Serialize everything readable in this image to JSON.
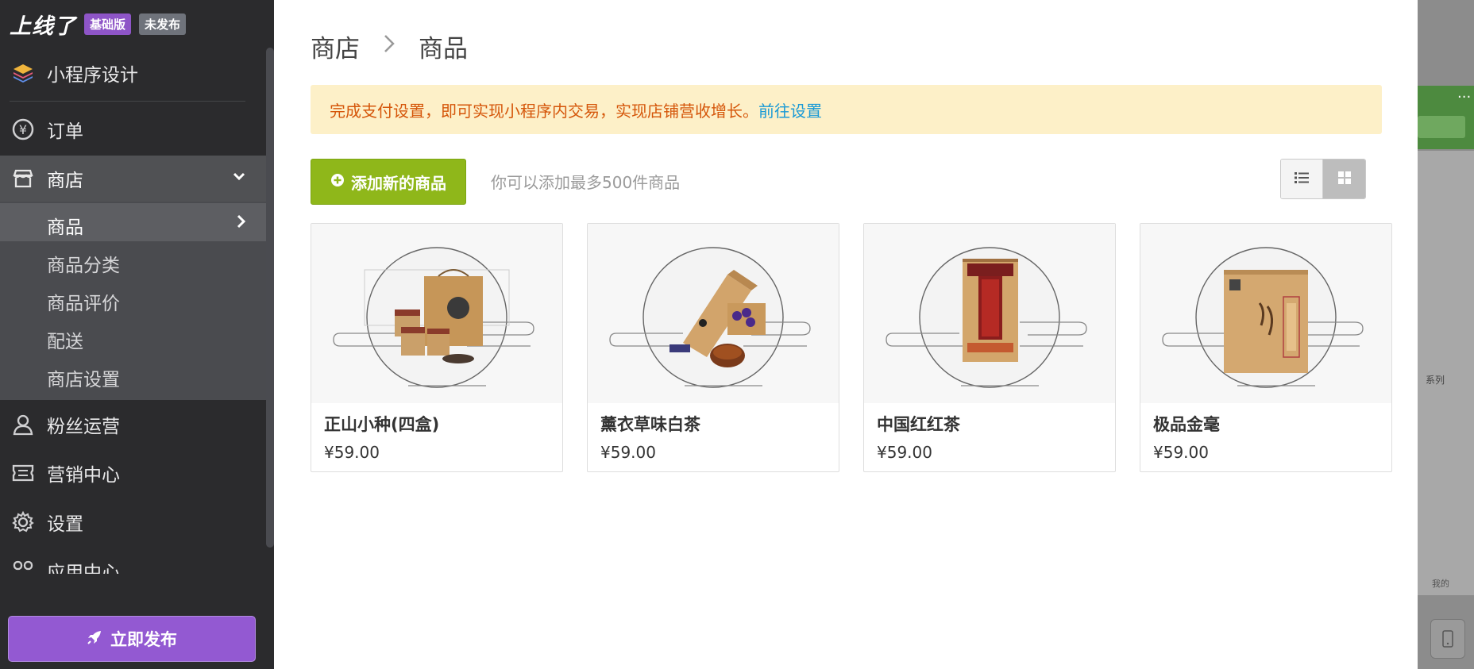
{
  "brand": {
    "logo_text": "上线了",
    "plan_badge": "基础版",
    "status_badge": "未发布"
  },
  "sidebar": {
    "items": [
      {
        "label": "小程序设计",
        "icon": "layers-icon"
      },
      {
        "label": "订单",
        "icon": "yen-circle-icon"
      },
      {
        "label": "商店",
        "icon": "store-icon",
        "expanded": true
      },
      {
        "label": "粉丝运营",
        "icon": "user-icon"
      },
      {
        "label": "营销中心",
        "icon": "ticket-icon"
      },
      {
        "label": "设置",
        "icon": "gear-icon"
      },
      {
        "label": "应用中心",
        "icon": "apps-icon"
      }
    ],
    "shop_sub_items": [
      {
        "label": "商品",
        "active": true
      },
      {
        "label": "商品分类"
      },
      {
        "label": "商品评价"
      },
      {
        "label": "配送"
      },
      {
        "label": "商店设置"
      }
    ],
    "publish_label": "立即发布"
  },
  "main": {
    "breadcrumb": [
      "商店",
      "商品"
    ],
    "notice": {
      "text": "完成支付设置，即可实现小程序内交易，实现店铺营收增长。",
      "link": "前往设置"
    },
    "add_button_label": "添加新的商品",
    "add_hint": "你可以添加最多500件商品",
    "view_mode": "grid",
    "products": [
      {
        "name": "正山小种(四盒)",
        "price": "¥59.00"
      },
      {
        "name": "薰衣草味白茶",
        "price": "¥59.00"
      },
      {
        "name": "中国红红茶",
        "price": "¥59.00"
      },
      {
        "name": "极品金毫",
        "price": "¥59.00"
      }
    ]
  },
  "preview": {
    "dots": "···",
    "series_label": "系列",
    "nav_label": "我的"
  },
  "colors": {
    "sidebar_bg": "#2b2b2d",
    "accent_purple": "#9359d2",
    "add_green": "#8fb71a",
    "notice_bg": "#fdf0c8",
    "notice_text": "#d5560a",
    "link_blue": "#1a9ad6"
  }
}
